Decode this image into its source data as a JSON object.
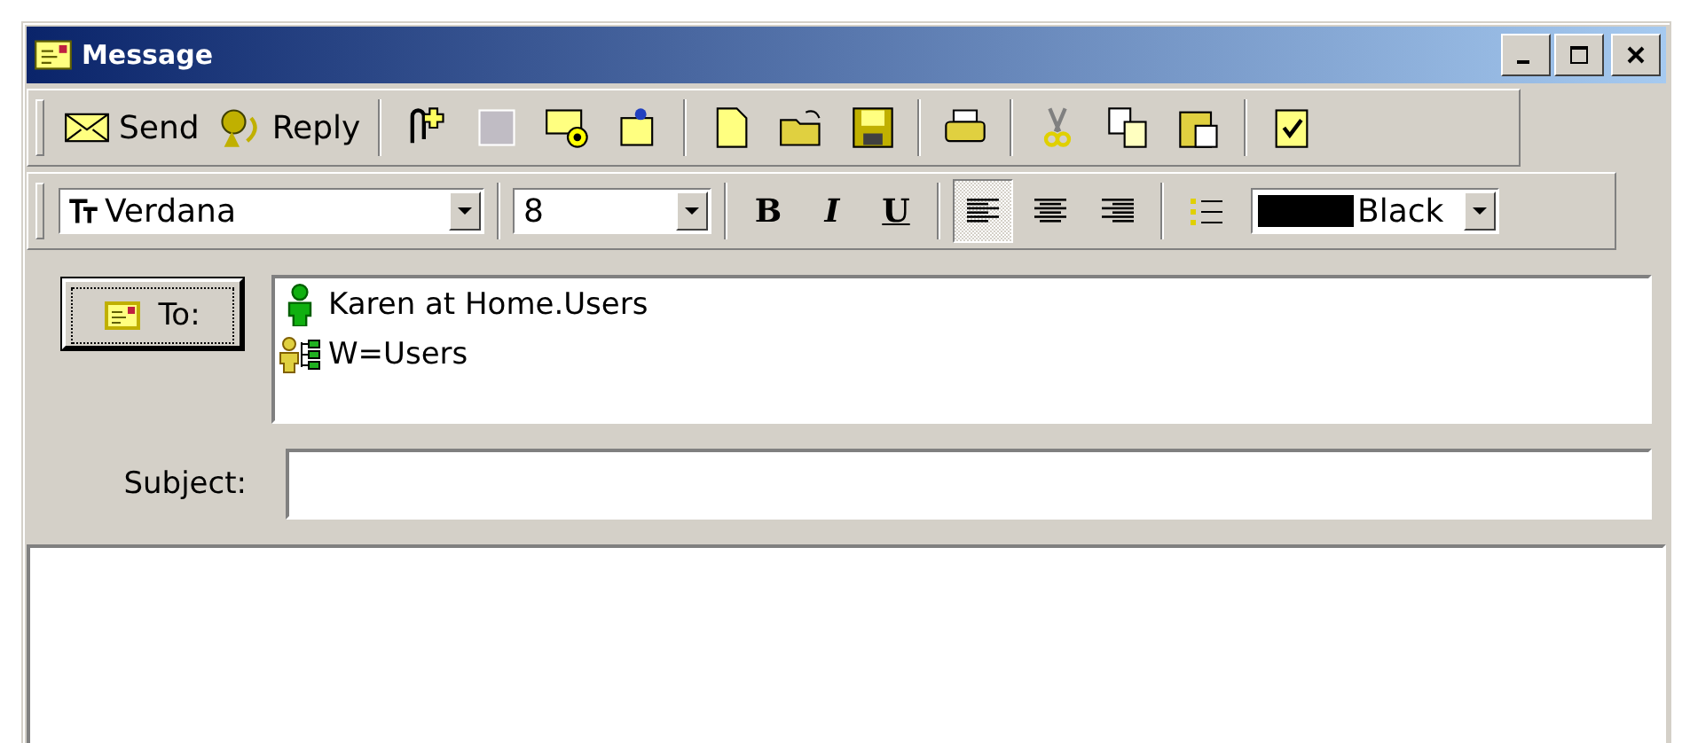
{
  "window": {
    "title": "Message"
  },
  "toolbar": {
    "send": "Send",
    "reply": "Reply"
  },
  "format_bar": {
    "font": "Verdana",
    "size": "8",
    "styles": [
      {
        "label": "B",
        "selected": false
      },
      {
        "label": "I",
        "selected": false
      },
      {
        "label": "U",
        "selected": false
      }
    ],
    "align": [
      {
        "selected": true
      },
      {
        "selected": false
      },
      {
        "selected": false
      }
    ],
    "color": {
      "name": "Black",
      "color": "#000000"
    }
  },
  "to_button": "To:",
  "recipients": [
    {
      "kind": "user",
      "name": "Karen at Home.Users"
    },
    {
      "kind": "group",
      "name": "W=Users"
    }
  ],
  "subject_label": "Subject:"
}
